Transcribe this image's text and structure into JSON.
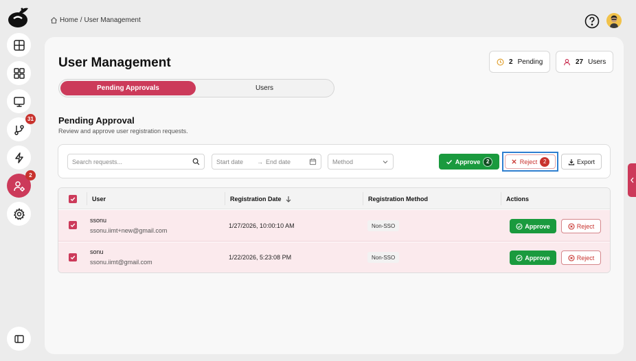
{
  "sidebar": {
    "logo_icon": "app-logo-icon",
    "items": [
      {
        "name": "dashboard",
        "icon": "layout-icon"
      },
      {
        "name": "apps",
        "icon": "grid-icon"
      },
      {
        "name": "monitor",
        "icon": "monitor-icon"
      },
      {
        "name": "workflows",
        "icon": "branch-icon",
        "badge": "31"
      },
      {
        "name": "automation",
        "icon": "bolt-icon"
      },
      {
        "name": "user-management",
        "icon": "user-gear-icon",
        "badge": "2",
        "active": true
      },
      {
        "name": "settings",
        "icon": "gear-icon"
      }
    ],
    "collapse_icon": "sidebar-toggle-icon"
  },
  "header": {
    "breadcrumb_home": "Home",
    "breadcrumb_sep": "/",
    "breadcrumb_current": "User Management"
  },
  "page": {
    "title": "User Management",
    "stats": {
      "pending_count": "2",
      "pending_label": "Pending",
      "users_count": "27",
      "users_label": "Users"
    },
    "tabs": {
      "pending": "Pending Approvals",
      "users": "Users"
    },
    "section_title": "Pending Approval",
    "section_subtitle": "Review and approve user registration requests."
  },
  "filters": {
    "search_placeholder": "Search requests...",
    "start_date": "Start date",
    "date_sep": "→",
    "end_date": "End date",
    "method_placeholder": "Method",
    "approve_label": "Approve",
    "approve_count": "2",
    "reject_label": "Reject",
    "reject_count": "2",
    "export_label": "Export"
  },
  "table": {
    "columns": {
      "user": "User",
      "date": "Registration Date",
      "method": "Registration Method",
      "actions": "Actions"
    },
    "rows": [
      {
        "name": "ssonu",
        "email": "ssonu.iimt+new@gmail.com",
        "date": "1/27/2026, 10:00:10 AM",
        "method": "Non-SSO",
        "approve": "Approve",
        "reject": "Reject"
      },
      {
        "name": "sonu",
        "email": "ssonu.iimt@gmail.com",
        "date": "1/22/2026, 5:23:08 PM",
        "method": "Non-SSO",
        "approve": "Approve",
        "reject": "Reject"
      }
    ]
  },
  "colors": {
    "accent": "#cc3a5a",
    "approve_green": "#1a9a3e",
    "reject_red": "#c8322d",
    "focus_blue": "#2e7fd0"
  }
}
